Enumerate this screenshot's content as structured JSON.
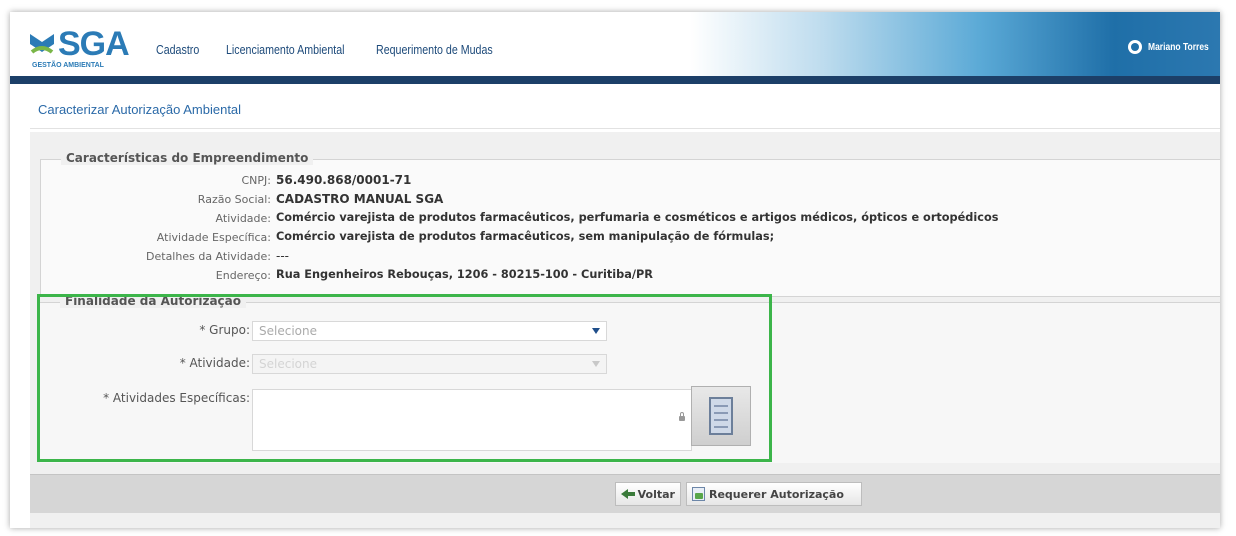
{
  "header": {
    "logo_text": "SGA",
    "logo_subtext": "GESTÃO AMBIENTAL",
    "nav": [
      "Cadastro",
      "Licenciamento Ambiental",
      "Requerimento de Mudas"
    ],
    "user_name": "Mariano Torres"
  },
  "page": {
    "title": "Caracterizar Autorização Ambiental"
  },
  "empreendimento": {
    "legend": "Características do Empreendimento",
    "fields": [
      {
        "label": "CNPJ:",
        "value": "56.490.868/0001-71"
      },
      {
        "label": "Razão Social:",
        "value": "CADASTRO MANUAL SGA"
      },
      {
        "label": "Atividade:",
        "value": "Comércio varejista de produtos farmacêuticos, perfumaria e cosméticos e artigos médicos, ópticos e ortopédicos"
      },
      {
        "label": "Atividade Específica:",
        "value": "Comércio varejista de produtos farmacêuticos, sem manipulação de fórmulas;"
      },
      {
        "label": "Detalhes da Atividade:",
        "value": "---"
      },
      {
        "label": "Endereço:",
        "value": "Rua Engenheiros Rebouças, 1206 - 80215-100 - Curitiba/PR"
      }
    ]
  },
  "finalidade": {
    "legend": "Finalidade da Autorização",
    "grupo_label": "* Grupo:",
    "grupo_value": "Selecione",
    "atividade_label": "* Atividade:",
    "atividade_value": "Selecione",
    "especificas_label": "* Atividades Específicas:"
  },
  "toolbar": {
    "voltar_label": "Voltar",
    "requerer_label": "Requerer Autorização"
  },
  "colors": {
    "header_bar": "#1c3f68",
    "highlight_box": "#3cb54a",
    "link_title": "#2b6aa8"
  },
  "icons": [
    "logo-icon",
    "globe-icon",
    "lock-icon",
    "checklist-icon",
    "back-arrow-icon",
    "request-icon",
    "dropdown-arrow-icon"
  ]
}
